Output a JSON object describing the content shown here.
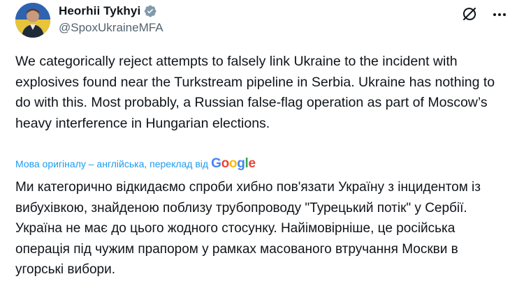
{
  "author": {
    "display_name": "Heorhii Tykhyi",
    "handle": "@SpoxUkraineMFA",
    "verified": true
  },
  "icons": {
    "avatar": "avatar-photo",
    "verified": "verified-badge-icon",
    "grok": "grok-icon",
    "more": "more-options-icon"
  },
  "tweet": {
    "text": "We categorically reject attempts to falsely link Ukraine to the incident with explosives found near the Turkstream pipeline in Serbia. Ukraine has nothing to do with this. Most probably, a Russian false-flag operation as part of Moscow’s heavy interference in Hungarian elections."
  },
  "translation": {
    "note": "Мова оригіналу – англійська, переклад від",
    "provider": "Google",
    "text": "Ми категорично відкидаємо спроби хибно пов'язати Україну з інцидентом із вибухівкою, знайденою поблизу трубопроводу \"Турецький потік\" у Сербії. Україна не має до цього жодного стосунку. Найімовірніше, це російська операція під чужим прапором у рамках масованого втручання Москви в угорські вибори."
  },
  "colors": {
    "link": "#1d9bf0",
    "secondary_text": "#536471",
    "primary_text": "#0f1419",
    "verified": "#829aab"
  }
}
